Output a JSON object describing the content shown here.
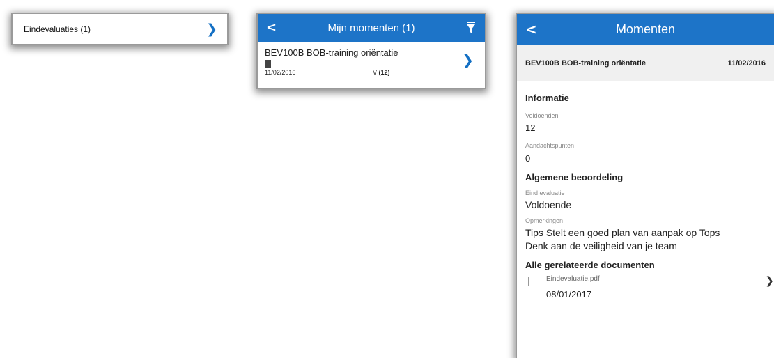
{
  "panel1": {
    "label": "Eindevaluaties (1)"
  },
  "panel2": {
    "back": "<",
    "title": "Mijn momenten (1)",
    "item": {
      "name": "BEV100B BOB-training oriëntatie",
      "date": "11/02/2016",
      "score_prefix": "V ",
      "score": "(12)"
    }
  },
  "panel3": {
    "back": "<",
    "title": "Momenten",
    "code": "BEV100B BOB-training oriëntatie",
    "date": "11/02/2016",
    "info_heading": "Informatie",
    "voldoenden_label": "Voldoenden",
    "voldoenden_value": "12",
    "aandacht_label": "Aandachtspunten",
    "aandacht_value": "0",
    "beoordeling_heading": "Algemene beoordeling",
    "eind_label": "Eind evaluatie",
    "eind_value": "Voldoende",
    "opm_label": "Opmerkingen",
    "opm_line1": "Tips Stelt een goed plan van aanpak op Tops",
    "opm_line2": "Denk aan de veiligheid van je team",
    "docs_heading": "Alle gerelateerde documenten",
    "doc_name": "Eindevaluatie.pdf",
    "doc_date": "08/01/2017"
  },
  "colors": {
    "header": "#1d74c8",
    "accent": "#1470c4",
    "subhead_bg": "#f0f0f0"
  },
  "icons": [
    "chevron-right-icon",
    "back-icon",
    "filter-icon",
    "document-icon",
    "pdf-icon"
  ]
}
